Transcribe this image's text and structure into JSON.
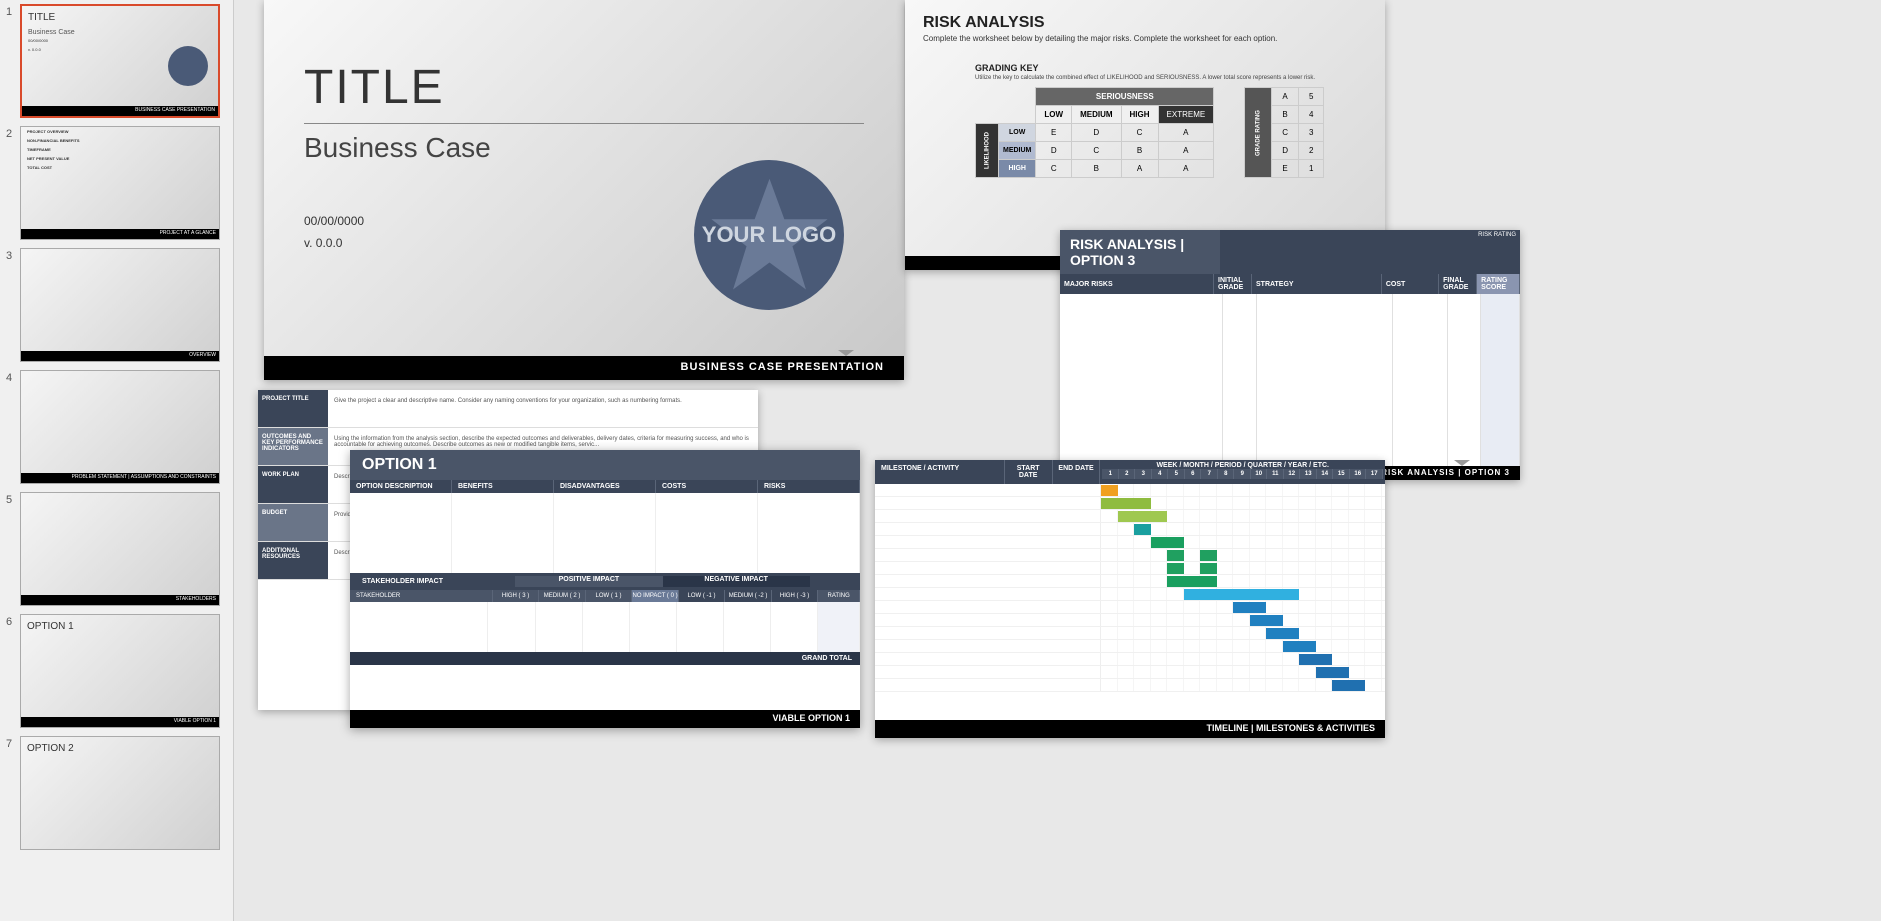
{
  "sidebar": {
    "thumbs": [
      {
        "num": "1",
        "title": "TITLE",
        "sub": "Business Case",
        "date": "00/00/0000",
        "ver": "v. 0.0.0",
        "footer": "BUSINESS CASE PRESENTATION",
        "hasLogo": true,
        "selected": true
      },
      {
        "num": "2",
        "footer": "PROJECT AT A GLANCE",
        "sections": [
          "PROJECT OVERVIEW",
          "NON-FINANCIAL BENEFITS",
          "TIMEFRAME",
          "NET PRESENT VALUE",
          "TOTAL COST"
        ]
      },
      {
        "num": "3",
        "footer": "OVERVIEW"
      },
      {
        "num": "4",
        "footer": "PROBLEM STATEMENT | ASSUMPTIONS AND CONSTRAINTS"
      },
      {
        "num": "5",
        "footer": "STAKEHOLDERS"
      },
      {
        "num": "6",
        "title": "OPTION 1",
        "footer": "VIABLE OPTION 1"
      },
      {
        "num": "7",
        "title": "OPTION 2"
      }
    ]
  },
  "mainSlide": {
    "title": "TITLE",
    "subtitle": "Business Case",
    "date": "00/00/0000",
    "version": "v. 0.0.0",
    "logo": "YOUR LOGO",
    "footer": "BUSINESS CASE PRESENTATION"
  },
  "riskSlide": {
    "title": "RISK ANALYSIS",
    "sub": "Complete the worksheet below by detailing the major risks.  Complete the worksheet for each option.",
    "gradingKey": "GRADING KEY",
    "gradingSub": "Utilize the key to calculate the combined effect of LIKELIHOOD and SERIOUSNESS. A lower total score represents a lower risk.",
    "seriousness": "SERIOUSNESS",
    "cols": [
      "LOW",
      "MEDIUM",
      "HIGH",
      "EXTREME"
    ],
    "likelihood": "LIKELIHOOD",
    "rows": [
      {
        "lbl": "LOW",
        "cells": [
          "E",
          "D",
          "C",
          "A"
        ]
      },
      {
        "lbl": "MEDIUM",
        "cells": [
          "D",
          "C",
          "B",
          "A"
        ]
      },
      {
        "lbl": "HIGH",
        "cells": [
          "C",
          "B",
          "A",
          "A"
        ]
      }
    ],
    "gradeRating": "GRADE RATING",
    "grades": [
      [
        "A",
        "5"
      ],
      [
        "B",
        "4"
      ],
      [
        "C",
        "3"
      ],
      [
        "D",
        "2"
      ],
      [
        "E",
        "1"
      ]
    ]
  },
  "riskOpt3": {
    "title": "RISK ANALYSIS | OPTION 3",
    "riskRating": "RISK RATING",
    "cols": [
      "MAJOR RISKS",
      "INITIAL GRADE",
      "STRATEGY",
      "COST",
      "FINAL GRADE",
      "RATING SCORE"
    ],
    "footer": "RISK ANALYSIS | OPTION 3"
  },
  "projForm": {
    "rows": [
      {
        "lbl": "PROJECT TITLE",
        "val": "Give the project a clear and descriptive name. Consider any naming conventions for your organization, such as numbering formats."
      },
      {
        "lbl": "OUTCOMES AND KEY PERFORMANCE INDICATORS",
        "val": "Using the information from the analysis section, describe the expected outcomes and deliverables, delivery dates, criteria for measuring success, and who is accountable for achieving outcomes. Describe outcomes as new or modified tangible items, servic..."
      },
      {
        "lbl": "WORK PLAN",
        "val": "Descr..."
      },
      {
        "lbl": "BUDGET",
        "val": "Provid..."
      },
      {
        "lbl": "ADDITIONAL RESOURCES",
        "val": "Descr..."
      }
    ]
  },
  "option1": {
    "title": "OPTION 1",
    "cols": [
      "OPTION DESCRIPTION",
      "BENEFITS",
      "DISADVANTAGES",
      "COSTS",
      "RISKS"
    ],
    "stakeImpact": "STAKEHOLDER IMPACT",
    "posImpact": "POSITIVE IMPACT",
    "negImpact": "NEGATIVE IMPACT",
    "stakeholder": "STAKEHOLDER",
    "impacts": [
      "HIGH ( 3 )",
      "MEDIUM ( 2 )",
      "LOW ( 1 )",
      "NO IMPACT ( 0 )",
      "LOW ( -1 )",
      "MEDIUM ( -2 )",
      "HIGH ( -3 )"
    ],
    "rating": "RATING",
    "grandTotal": "GRAND TOTAL",
    "footer": "VIABLE OPTION 1"
  },
  "timeline": {
    "cols": [
      "MILESTONE / ACTIVITY",
      "START DATE",
      "END DATE"
    ],
    "periodHeader": "WEEK / MONTH / PERIOD / QUARTER / YEAR / ETC.",
    "nums": [
      "1",
      "2",
      "3",
      "4",
      "5",
      "6",
      "7",
      "8",
      "9",
      "10",
      "11",
      "12",
      "13",
      "14",
      "15",
      "16",
      "17"
    ],
    "footer": "TIMELINE | MILESTONES & ACTIVITIES",
    "bars": [
      {
        "row": 0,
        "start": 0,
        "len": 1,
        "color": "#f0a020"
      },
      {
        "row": 1,
        "start": 0,
        "len": 3,
        "color": "#8fbc3f"
      },
      {
        "row": 2,
        "start": 1,
        "len": 3,
        "color": "#9fc850"
      },
      {
        "row": 3,
        "start": 2,
        "len": 1,
        "color": "#1a9f9f"
      },
      {
        "row": 4,
        "start": 3,
        "len": 2,
        "color": "#1a9f5f"
      },
      {
        "row": 5,
        "start": 4,
        "len": 1,
        "color": "#20a060"
      },
      {
        "row": 5,
        "start": 6,
        "len": 1,
        "color": "#20a060"
      },
      {
        "row": 6,
        "start": 4,
        "len": 1,
        "color": "#20a060"
      },
      {
        "row": 6,
        "start": 6,
        "len": 1,
        "color": "#20a060"
      },
      {
        "row": 7,
        "start": 4,
        "len": 3,
        "color": "#1a9f5f"
      },
      {
        "row": 8,
        "start": 5,
        "len": 7,
        "color": "#30b0e0"
      },
      {
        "row": 9,
        "start": 8,
        "len": 2,
        "color": "#2080c0"
      },
      {
        "row": 10,
        "start": 9,
        "len": 2,
        "color": "#2080c0"
      },
      {
        "row": 11,
        "start": 10,
        "len": 2,
        "color": "#2080c0"
      },
      {
        "row": 12,
        "start": 11,
        "len": 2,
        "color": "#2080c0"
      },
      {
        "row": 13,
        "start": 12,
        "len": 2,
        "color": "#2070b0"
      },
      {
        "row": 14,
        "start": 13,
        "len": 2,
        "color": "#2070b0"
      },
      {
        "row": 15,
        "start": 14,
        "len": 2,
        "color": "#2070b0"
      }
    ]
  }
}
